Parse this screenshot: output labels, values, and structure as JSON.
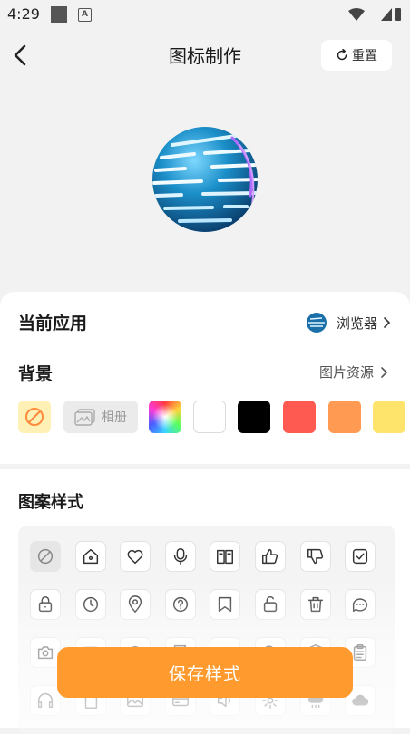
{
  "status_bar": {
    "time": "4:29",
    "a_badge": "A"
  },
  "header": {
    "title": "图标制作",
    "reset_label": "重置"
  },
  "current_app": {
    "label": "当前应用",
    "value": "浏览器"
  },
  "background": {
    "label": "背景",
    "link_label": "图片资源",
    "album_label": "相册",
    "swatches": [
      "rainbow",
      "#ffffff",
      "#000000",
      "#ff5a52",
      "#ff9a52",
      "#ffe46b"
    ]
  },
  "patterns": {
    "label": "图案样式",
    "icons": [
      [
        "no-pattern-icon",
        "home-icon",
        "heart-icon",
        "microphone-icon",
        "book-icon",
        "thumbs-up-icon",
        "thumbs-down-icon",
        "checkbox-icon"
      ],
      [
        "lock-icon",
        "clock-icon",
        "location-pin-icon",
        "help-icon",
        "bookmark-icon",
        "unlock-icon",
        "trash-icon",
        "chat-bubble-icon"
      ],
      [
        "camera-icon",
        "mail-icon",
        "bell-icon",
        "flag-icon",
        "megaphone-icon",
        "search-icon",
        "shield-icon",
        "clipboard-icon"
      ],
      [
        "headphones-icon",
        "document-icon",
        "image-icon",
        "card-icon",
        "speaker-icon",
        "settings-icon",
        "cloud-rain-icon",
        "cloud-icon"
      ]
    ]
  },
  "save_label": "保存样式",
  "colors": {
    "accent": "#ff9a2e",
    "panel": "#ffffff",
    "page_bg": "#f2f2f2"
  }
}
